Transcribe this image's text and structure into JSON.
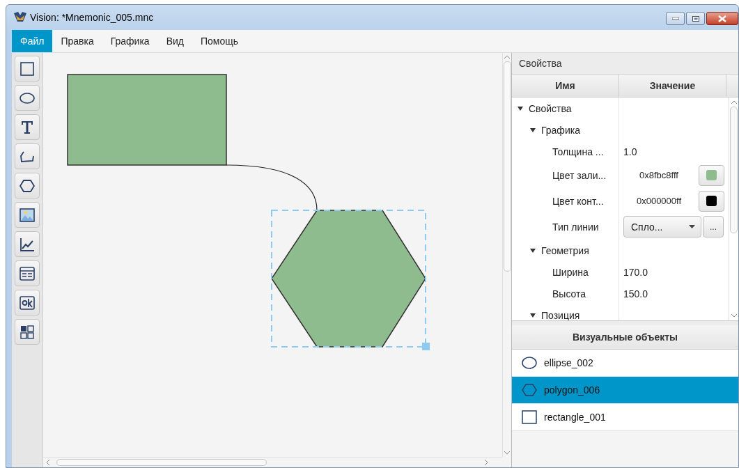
{
  "window": {
    "title": "Vision: *Mnemonic_005.mnc"
  },
  "menu": [
    {
      "label": "Файл",
      "selected": true
    },
    {
      "label": "Правка",
      "selected": false
    },
    {
      "label": "Графика",
      "selected": false
    },
    {
      "label": "Вид",
      "selected": false
    },
    {
      "label": "Помощь",
      "selected": false
    }
  ],
  "properties": {
    "title": "Свойства",
    "columns": [
      "Имя",
      "Значение"
    ],
    "rows": [
      {
        "name": "Свойства",
        "kind": "group",
        "expanded": true,
        "children": [
          {
            "name": "Графика",
            "kind": "group",
            "expanded": true,
            "children": [
              {
                "name": "Толщина ...",
                "kind": "text",
                "value": "1.0"
              },
              {
                "name": "Цвет зали...",
                "kind": "color",
                "value": "0x8fbc8fff",
                "color": "#8fbc8f"
              },
              {
                "name": "Цвет конт...",
                "kind": "color",
                "value": "0x000000ff",
                "color": "#000000"
              },
              {
                "name": "Тип линии",
                "kind": "select",
                "value": "Спло...",
                "button": "..."
              }
            ]
          },
          {
            "name": "Геометрия",
            "kind": "group",
            "expanded": true,
            "children": [
              {
                "name": "Ширина",
                "kind": "text",
                "value": "170.0"
              },
              {
                "name": "Высота",
                "kind": "text",
                "value": "150.0"
              }
            ]
          },
          {
            "name": "Позиция",
            "kind": "group",
            "expanded": true
          }
        ]
      }
    ]
  },
  "objects": {
    "title": "Визуальные объекты",
    "items": [
      {
        "label": "ellipse_002",
        "kind": "ellipse",
        "selected": false
      },
      {
        "label": "polygon_006",
        "kind": "polygon",
        "selected": true
      },
      {
        "label": "rectangle_001",
        "kind": "rectangle",
        "selected": false
      }
    ]
  }
}
